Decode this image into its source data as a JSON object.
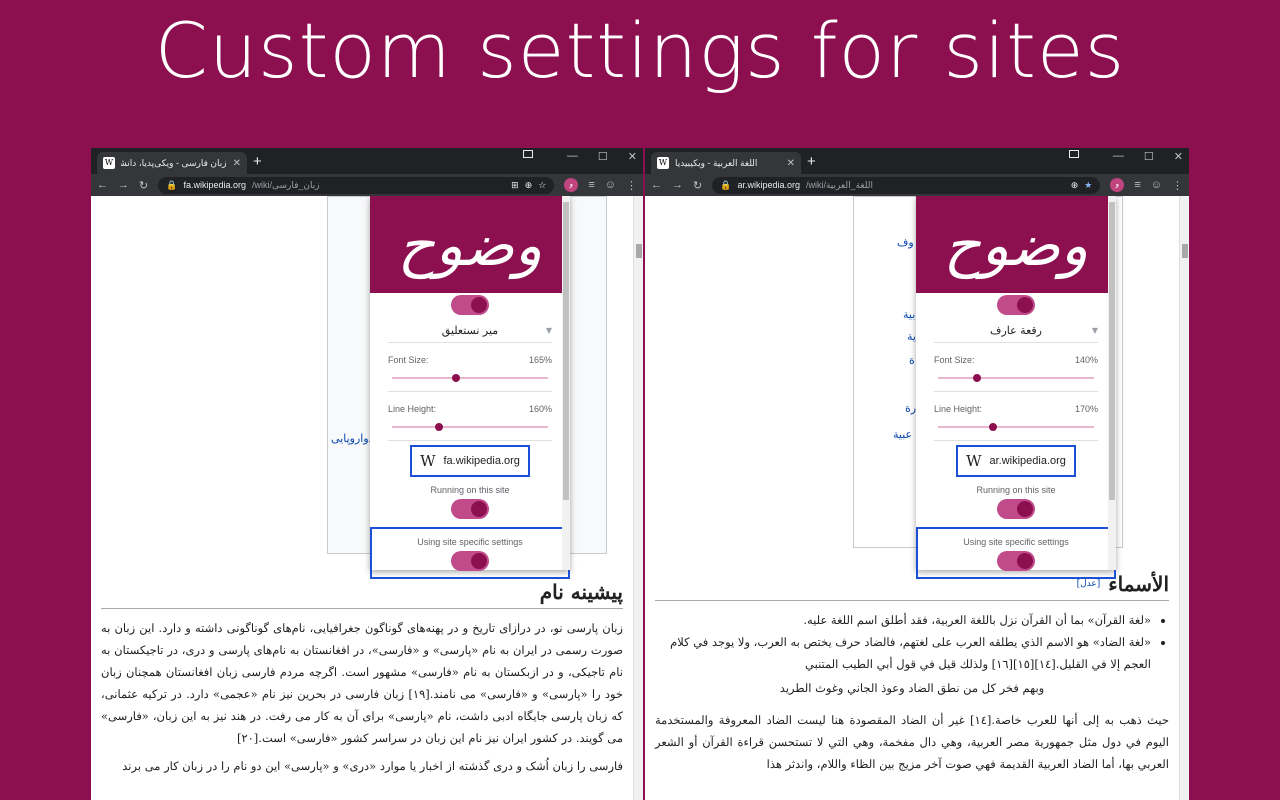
{
  "headline": "Custom settings for sites",
  "colors": {
    "brand": "#8c0f50",
    "toggle_track": "#c04a8a",
    "highlight": "#1a4fd6",
    "link": "#0645ad"
  },
  "left": {
    "tab_title": "زبان فارسی - ویکی‌پدیا، دانشنامهٔ آزاد",
    "url_host": "fa.wikipedia.org",
    "url_path": "/wiki/زبان_فارسی",
    "link_text": "هندواروپایی",
    "popup": {
      "font_name": "میر نستعلیق",
      "font_size_label": "Font Size:",
      "font_size_value": "165%",
      "font_size_level": 0.41,
      "line_height_label": "Line Height:",
      "line_height_value": "160%",
      "line_height_level": 0.3,
      "site": "fa.wikipedia.org",
      "running_label": "Running on this site",
      "site_specific_label": "Using site specific settings"
    },
    "article": {
      "heading": "پیشینه نام",
      "para1": "زبان پارسی نو، در درازای تاریخ و در پهنه‌های گوناگون جغرافیایی، نام‌های گوناگونی داشته و دارد. این زبان به صورت رسمی در ایران به نام «پارسی» و «فارسی»، در افغانستان به نام‌های پارسی و دری، در تاجیکستان به نام تاجیکی، و در ازبکستان به نام «فارسی» مشهور است. اگرچه مردم فارسی زبان افغانستان همچنان زبان خود را «پارسی» و «فارسی» می نامند.[۱۹] زبان فارسی در بحرین نیز نام «عجمی» دارد. در ترکیه عثمانی، که زبان پارسی جایگاه ادبی داشت، نام «پارسی» برای آن به کار می رفت. در هند نیز به این زبان، «فارسی» می گویند. در کشور ایران نیز نام این زبان در سراسر کشور «فارسی» است.[۲۰]",
      "para2": "فارسی را زبان اُشک و دری گذشته از اخبار یا موارد «دری» و «پارسی» این دو نام را در زبان کار می برند"
    }
  },
  "right": {
    "tab_title": "اللغة العربية - ويكيبيديا",
    "url_host": "ar.wikipedia.org",
    "url_path": "/wiki/اللغة_العربية",
    "links": [
      "وف",
      "بية",
      "ية",
      "ة",
      "رة",
      "عبية"
    ],
    "popup": {
      "font_name": "رقعة عارف",
      "font_size_label": "Font Size:",
      "font_size_value": "140%",
      "font_size_level": 0.25,
      "line_height_label": "Line Height:",
      "line_height_value": "170%",
      "line_height_level": 0.35,
      "site": "ar.wikipedia.org",
      "running_label": "Running on this site",
      "site_specific_label": "Using site specific settings"
    },
    "article": {
      "heading": "الأسماء",
      "edit_label": "[عدل]",
      "items": [
        "«لغة القرآن» بما أن القرآن نزل باللغة العربية، فقد أطلق اسم اللغة عليه.",
        "«لغة الضاد» هو الاسم الذي يطلقه العرب على لغتهم، فالضاد حرف يختص به العرب، ولا يوجد في كلام العجم إلا في القليل.[١٤][١٥][١٦] ولذلك قيل في قول أبي الطيب المتنبي"
      ],
      "verse": "وبهم فخر كل من نطق الضاد     وعوذ الجاني وغوث الطريد",
      "para": "حيث ذهب به إلى أنها للعرب خاصة.[١٤] غير أن الضاد المقصودة هنا ليست الضاد المعروفة والمستخدمة اليوم في دول مثل جمهورية مصر العربية، وهي دال مفخمة، وهي التي لا تستحسن قراءة القرآن أو الشعر العربي بها، أما الضاد العربية القديمة فهي صوت آخر مزيج بين الظاء واللام، واندثر هذا"
    }
  },
  "popup_logo": "وضوح",
  "icons": {
    "reload": "reload-icon",
    "back": "back-arrow-icon",
    "forward": "forward-arrow-icon",
    "lock": "lock-icon",
    "star": "star-icon",
    "zoom": "zoom-icon",
    "translate": "translate-icon",
    "extension": "wazooh-extension-icon",
    "profile": "profile-icon",
    "menu": "kebab-menu-icon",
    "reading_list": "reading-list-icon"
  }
}
